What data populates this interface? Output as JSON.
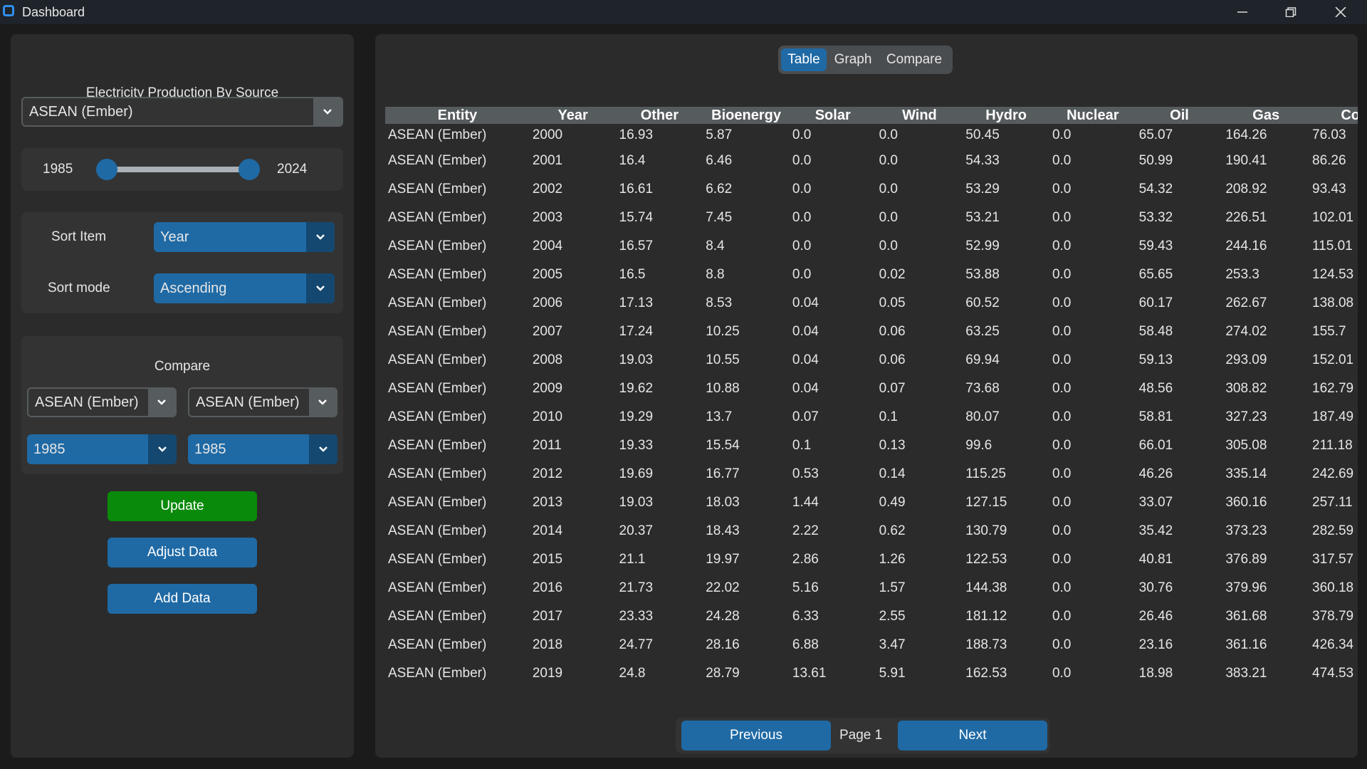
{
  "window": {
    "title": "Dashboard",
    "controls": [
      "minimize-icon",
      "restore-icon",
      "close-icon"
    ]
  },
  "sidebar": {
    "title": "Electricity Production By Source",
    "entity_select": "ASEAN (Ember)",
    "range": {
      "min_label": "1985",
      "max_label": "2024",
      "start_fraction": 0.0,
      "end_fraction": 1.0
    },
    "sort": {
      "item_label": "Sort Item",
      "item_value": "Year",
      "mode_label": "Sort mode",
      "mode_value": "Ascending"
    },
    "compare": {
      "title": "Compare",
      "entity_a": "ASEAN (Ember)",
      "entity_b": "ASEAN (Ember)",
      "year_a": "1985",
      "year_b": "1985"
    },
    "buttons": {
      "update": "Update",
      "adjust": "Adjust Data",
      "add": "Add Data"
    }
  },
  "main": {
    "tabs": [
      {
        "label": "Table",
        "active": true
      },
      {
        "label": "Graph",
        "active": false
      },
      {
        "label": "Compare",
        "active": false
      }
    ],
    "table": {
      "columns": [
        "Entity",
        "Year",
        "Other",
        "Bioenergy",
        "Solar",
        "Wind",
        "Hydro",
        "Nuclear",
        "Oil",
        "Gas",
        "Coal"
      ],
      "rows": [
        [
          "ASEAN (Ember)",
          "2000",
          "16.93",
          "5.87",
          "0.0",
          "0.0",
          "50.45",
          "0.0",
          "65.07",
          "164.26",
          "76.03"
        ],
        [
          "ASEAN (Ember)",
          "2001",
          "16.4",
          "6.46",
          "0.0",
          "0.0",
          "54.33",
          "0.0",
          "50.99",
          "190.41",
          "86.26"
        ],
        [
          "ASEAN (Ember)",
          "2002",
          "16.61",
          "6.62",
          "0.0",
          "0.0",
          "53.29",
          "0.0",
          "54.32",
          "208.92",
          "93.43"
        ],
        [
          "ASEAN (Ember)",
          "2003",
          "15.74",
          "7.45",
          "0.0",
          "0.0",
          "53.21",
          "0.0",
          "53.32",
          "226.51",
          "102.01"
        ],
        [
          "ASEAN (Ember)",
          "2004",
          "16.57",
          "8.4",
          "0.0",
          "0.0",
          "52.99",
          "0.0",
          "59.43",
          "244.16",
          "115.01"
        ],
        [
          "ASEAN (Ember)",
          "2005",
          "16.5",
          "8.8",
          "0.0",
          "0.02",
          "53.88",
          "0.0",
          "65.65",
          "253.3",
          "124.53"
        ],
        [
          "ASEAN (Ember)",
          "2006",
          "17.13",
          "8.53",
          "0.04",
          "0.05",
          "60.52",
          "0.0",
          "60.17",
          "262.67",
          "138.08"
        ],
        [
          "ASEAN (Ember)",
          "2007",
          "17.24",
          "10.25",
          "0.04",
          "0.06",
          "63.25",
          "0.0",
          "58.48",
          "274.02",
          "155.7"
        ],
        [
          "ASEAN (Ember)",
          "2008",
          "19.03",
          "10.55",
          "0.04",
          "0.06",
          "69.94",
          "0.0",
          "59.13",
          "293.09",
          "152.01"
        ],
        [
          "ASEAN (Ember)",
          "2009",
          "19.62",
          "10.88",
          "0.04",
          "0.07",
          "73.68",
          "0.0",
          "48.56",
          "308.82",
          "162.79"
        ],
        [
          "ASEAN (Ember)",
          "2010",
          "19.29",
          "13.7",
          "0.07",
          "0.1",
          "80.07",
          "0.0",
          "58.81",
          "327.23",
          "187.49"
        ],
        [
          "ASEAN (Ember)",
          "2011",
          "19.33",
          "15.54",
          "0.1",
          "0.13",
          "99.6",
          "0.0",
          "66.01",
          "305.08",
          "211.18"
        ],
        [
          "ASEAN (Ember)",
          "2012",
          "19.69",
          "16.77",
          "0.53",
          "0.14",
          "115.25",
          "0.0",
          "46.26",
          "335.14",
          "242.69"
        ],
        [
          "ASEAN (Ember)",
          "2013",
          "19.03",
          "18.03",
          "1.44",
          "0.49",
          "127.15",
          "0.0",
          "33.07",
          "360.16",
          "257.11"
        ],
        [
          "ASEAN (Ember)",
          "2014",
          "20.37",
          "18.43",
          "2.22",
          "0.62",
          "130.79",
          "0.0",
          "35.42",
          "373.23",
          "282.59"
        ],
        [
          "ASEAN (Ember)",
          "2015",
          "21.1",
          "19.97",
          "2.86",
          "1.26",
          "122.53",
          "0.0",
          "40.81",
          "376.89",
          "317.57"
        ],
        [
          "ASEAN (Ember)",
          "2016",
          "21.73",
          "22.02",
          "5.16",
          "1.57",
          "144.38",
          "0.0",
          "30.76",
          "379.96",
          "360.18"
        ],
        [
          "ASEAN (Ember)",
          "2017",
          "23.33",
          "24.28",
          "6.33",
          "2.55",
          "181.12",
          "0.0",
          "26.46",
          "361.68",
          "378.79"
        ],
        [
          "ASEAN (Ember)",
          "2018",
          "24.77",
          "28.16",
          "6.88",
          "3.47",
          "188.73",
          "0.0",
          "23.16",
          "361.16",
          "426.34"
        ],
        [
          "ASEAN (Ember)",
          "2019",
          "24.8",
          "28.79",
          "13.61",
          "5.91",
          "162.53",
          "0.0",
          "18.98",
          "383.21",
          "474.53"
        ]
      ]
    },
    "pager": {
      "previous": "Previous",
      "page": "Page 1",
      "next": "Next"
    }
  },
  "colors": {
    "accent": "#1f6aa5",
    "accent_dark": "#144870",
    "update_green": "#0a8a0a",
    "panel": "#2b2b2b",
    "header": "#565b5e"
  }
}
